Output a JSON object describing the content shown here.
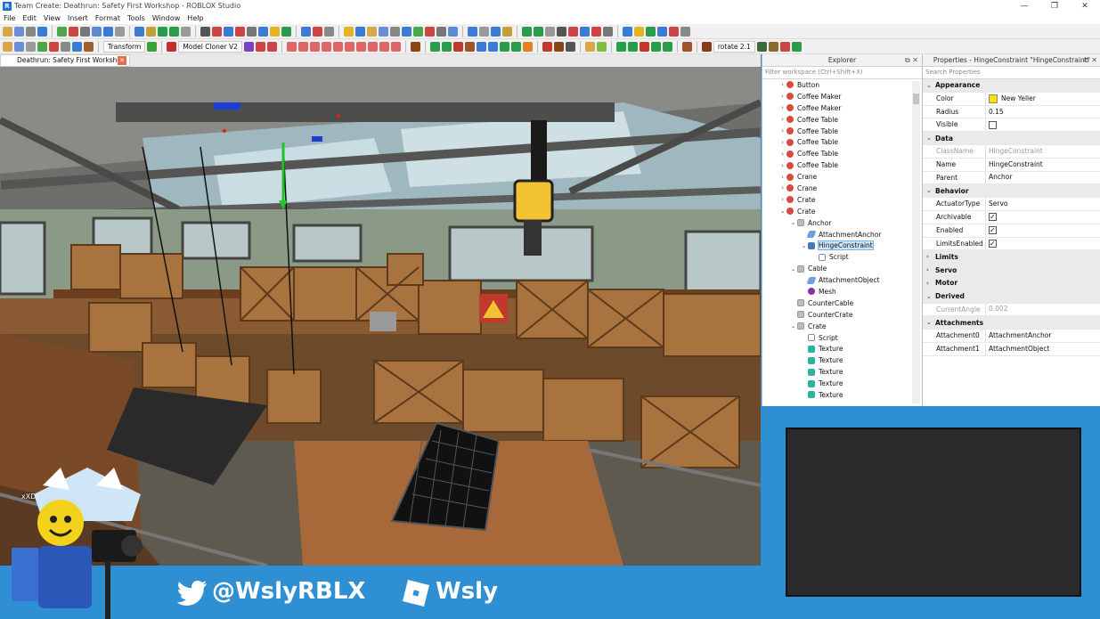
{
  "window": {
    "title": "Team Create: Deathrun: Safety First Workshop - ROBLOX Studio"
  },
  "menu": [
    "File",
    "Edit",
    "View",
    "Insert",
    "Format",
    "Tools",
    "Window",
    "Help"
  ],
  "toolbar": {
    "transform_label": "Transform",
    "model_cloner_label": "Model Cloner V2",
    "rotate_label": "rotate 2.1"
  },
  "document_tab": {
    "label": "Deathrun: Safety First Workshop"
  },
  "viewport": {
    "player_name": "xXDJducklingXx"
  },
  "explorer": {
    "title": "Explorer",
    "filter_placeholder": "Filter workspace (Ctrl+Shift+X)",
    "items": [
      {
        "label": "Button",
        "depth": 0,
        "icon": "model-icon",
        "arrow": "›"
      },
      {
        "label": "Coffee Maker",
        "depth": 0,
        "icon": "model-icon",
        "arrow": "›"
      },
      {
        "label": "Coffee Maker",
        "depth": 0,
        "icon": "model-icon",
        "arrow": "›"
      },
      {
        "label": "Coffee Table",
        "depth": 0,
        "icon": "model-icon",
        "arrow": "›"
      },
      {
        "label": "Coffee Table",
        "depth": 0,
        "icon": "model-icon",
        "arrow": "›"
      },
      {
        "label": "Coffee Table",
        "depth": 0,
        "icon": "model-icon",
        "arrow": "›"
      },
      {
        "label": "Coffee Table",
        "depth": 0,
        "icon": "model-icon",
        "arrow": "›"
      },
      {
        "label": "Coffee Table",
        "depth": 0,
        "icon": "model-icon",
        "arrow": "›"
      },
      {
        "label": "Crane",
        "depth": 0,
        "icon": "model-icon",
        "arrow": "›"
      },
      {
        "label": "Crane",
        "depth": 0,
        "icon": "model-icon",
        "arrow": "›"
      },
      {
        "label": "Crate",
        "depth": 0,
        "icon": "model-icon",
        "arrow": "›"
      },
      {
        "label": "Crate",
        "depth": 0,
        "icon": "model-icon",
        "arrow": "⌄"
      },
      {
        "label": "Anchor",
        "depth": 1,
        "icon": "part-icon",
        "arrow": "⌄"
      },
      {
        "label": "AttachmentAnchor",
        "depth": 2,
        "icon": "attachment-icon",
        "arrow": ""
      },
      {
        "label": "HingeConstraint",
        "depth": 2,
        "icon": "hinge-icon",
        "arrow": "⌄",
        "selected": true
      },
      {
        "label": "Script",
        "depth": 3,
        "icon": "script-icon",
        "arrow": ""
      },
      {
        "label": "Cable",
        "depth": 1,
        "icon": "part-icon",
        "arrow": "⌄"
      },
      {
        "label": "AttachmentObject",
        "depth": 2,
        "icon": "attachment-icon",
        "arrow": ""
      },
      {
        "label": "Mesh",
        "depth": 2,
        "icon": "mesh-icon",
        "arrow": ""
      },
      {
        "label": "CounterCable",
        "depth": 1,
        "icon": "part-icon",
        "arrow": ""
      },
      {
        "label": "CounterCrate",
        "depth": 1,
        "icon": "part-icon",
        "arrow": ""
      },
      {
        "label": "Crate",
        "depth": 1,
        "icon": "part-icon",
        "arrow": "⌄"
      },
      {
        "label": "Script",
        "depth": 2,
        "icon": "script-icon",
        "arrow": ""
      },
      {
        "label": "Texture",
        "depth": 2,
        "icon": "texture-icon",
        "arrow": ""
      },
      {
        "label": "Texture",
        "depth": 2,
        "icon": "texture-icon",
        "arrow": ""
      },
      {
        "label": "Texture",
        "depth": 2,
        "icon": "texture-icon",
        "arrow": ""
      },
      {
        "label": "Texture",
        "depth": 2,
        "icon": "texture-icon",
        "arrow": ""
      },
      {
        "label": "Texture",
        "depth": 2,
        "icon": "texture-icon",
        "arrow": ""
      }
    ]
  },
  "properties": {
    "title": "Properties - HingeConstraint \"HingeConstraint\"",
    "search_placeholder": "Search Properties",
    "rows": [
      {
        "type": "cat",
        "label": "Appearance",
        "arrow": "⌄"
      },
      {
        "type": "prop",
        "name": "Color",
        "value": "New Yeller",
        "swatch": "#ffe100"
      },
      {
        "type": "prop",
        "name": "Radius",
        "value": "0.15"
      },
      {
        "type": "prop",
        "name": "Visible",
        "check": false
      },
      {
        "type": "cat",
        "label": "Data",
        "arrow": "⌄"
      },
      {
        "type": "prop",
        "name": "ClassName",
        "value": "HingeConstraint",
        "dim": true
      },
      {
        "type": "prop",
        "name": "Name",
        "value": "HingeConstraint"
      },
      {
        "type": "prop",
        "name": "Parent",
        "value": "Anchor"
      },
      {
        "type": "cat",
        "label": "Behavior",
        "arrow": "⌄"
      },
      {
        "type": "prop",
        "name": "ActuatorType",
        "value": "Servo"
      },
      {
        "type": "prop",
        "name": "Archivable",
        "check": true
      },
      {
        "type": "prop",
        "name": "Enabled",
        "check": true
      },
      {
        "type": "prop",
        "name": "LimitsEnabled",
        "check": true
      },
      {
        "type": "cat",
        "label": "Limits",
        "arrow": "›"
      },
      {
        "type": "cat",
        "label": "Servo",
        "arrow": "›"
      },
      {
        "type": "cat",
        "label": "Motor",
        "arrow": "›"
      },
      {
        "type": "cat",
        "label": "Derived",
        "arrow": "⌄"
      },
      {
        "type": "prop",
        "name": "CurrentAngle",
        "value": "0.002",
        "dim": true
      },
      {
        "type": "cat",
        "label": "Attachments",
        "arrow": "⌄"
      },
      {
        "type": "prop",
        "name": "Attachment0",
        "value": "AttachmentAnchor"
      },
      {
        "type": "prop",
        "name": "Attachment1",
        "value": "AttachmentObject"
      }
    ]
  },
  "overlay": {
    "twitter_handle": "@WslyRBLX",
    "roblox_name": "Wsly"
  },
  "colors": {
    "accent": "#2e8fd3",
    "selection": "#cbe3fb"
  }
}
